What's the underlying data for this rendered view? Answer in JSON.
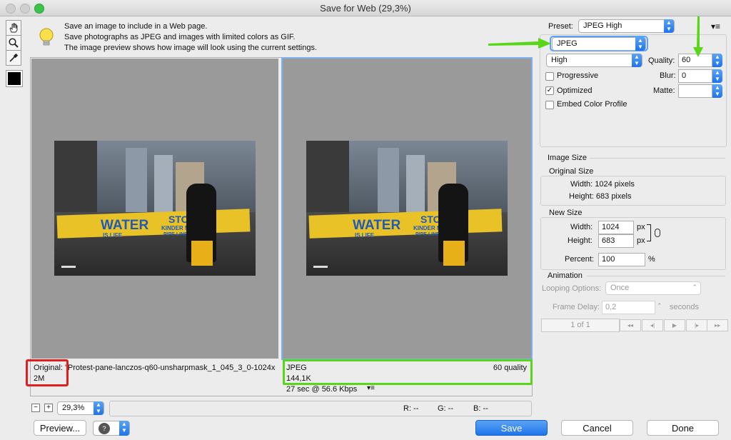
{
  "window": {
    "title": "Save for Web (29,3%)"
  },
  "info": {
    "lines": [
      "Save an image to include in a Web page.",
      "Save photographs as JPEG and images with limited colors as GIF.",
      "The image preview shows how image will look using the current settings."
    ]
  },
  "panes": {
    "original": {
      "label": "Original: \"Protest-pane-lanczos-q60-unsharpmask_1_045_3_0-1024x",
      "size": "2M"
    },
    "optimized": {
      "format": "JPEG",
      "quality": "60 quality",
      "size": "144,1K",
      "time": "27 sec @ 56.6 Kbps"
    },
    "photo": {
      "banner_main": "WATER",
      "banner_sub": "IS LIFE",
      "banner_right": "STO",
      "banner_right2": "KINDER MO",
      "banner_right3": "PIPE LINE"
    }
  },
  "bottom": {
    "zoom": "29,3%",
    "r": "R: --",
    "g": "G: --",
    "b": "B: --",
    "preview_btn": "Preview...",
    "save_btn": "Save",
    "cancel_btn": "Cancel",
    "done_btn": "Done"
  },
  "settings": {
    "preset_label": "Preset:",
    "preset_value": "JPEG High",
    "format_value": "JPEG",
    "quality_level": "High",
    "quality_label": "Quality:",
    "quality_value": "60",
    "progressive_label": "Progressive",
    "progressive_checked": false,
    "blur_label": "Blur:",
    "blur_value": "0",
    "optimized_label": "Optimized",
    "optimized_checked": true,
    "matte_label": "Matte:",
    "matte_value": "",
    "embed_label": "Embed Color Profile",
    "embed_checked": false
  },
  "image_size": {
    "heading": "Image Size",
    "original_heading": "Original Size",
    "orig_width": "Width:  1024 pixels",
    "orig_height": "Height:  683 pixels",
    "new_heading": "New Size",
    "width_label": "Width:",
    "width_value": "1024",
    "height_label": "Height:",
    "height_value": "683",
    "px": "px",
    "percent_label": "Percent:",
    "percent_value": "100",
    "percent_sign": "%"
  },
  "animation": {
    "heading": "Animation",
    "looping_label": "Looping Options:",
    "looping_value": "Once",
    "delay_label": "Frame Delay:",
    "delay_value": "0,2",
    "delay_unit": "seconds",
    "frame_counter": "1 of 1"
  },
  "colors": {
    "accent": "#1f74ea",
    "highlight_green": "#59d51a",
    "highlight_red": "#e02020"
  }
}
